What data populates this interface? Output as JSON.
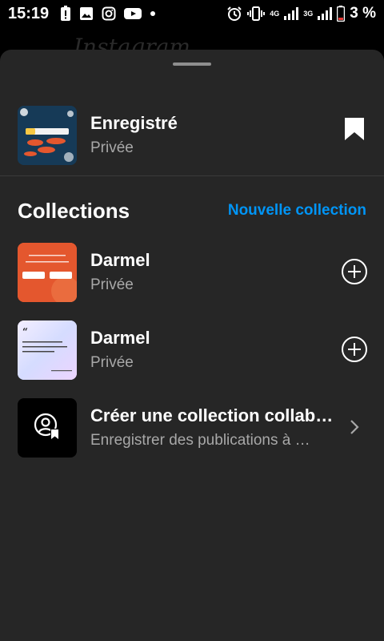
{
  "status_bar": {
    "time": "15:19",
    "network_4g": "4G",
    "network_3g": "3G",
    "battery_percent": "3 %",
    "icons": [
      "alert-icon",
      "gallery-icon",
      "instagram-icon",
      "youtube-icon",
      "dot-icon",
      "alarm-icon",
      "vibrate-icon",
      "signal-icon",
      "battery-icon"
    ]
  },
  "background_app": {
    "title": "Instagram"
  },
  "saved": {
    "title": "Enregistré",
    "subtitle": "Privée",
    "icon": "bookmark-icon"
  },
  "collections": {
    "heading": "Collections",
    "new_collection_label": "Nouvelle collection",
    "items": [
      {
        "title": "Darmel",
        "subtitle": "Privée",
        "action_icon": "add-circle-icon"
      },
      {
        "title": "Darmel",
        "subtitle": "Privée",
        "action_icon": "add-circle-icon"
      }
    ],
    "collab": {
      "title": "Créer une collection collab…",
      "subtitle": "Enregistrer des publications à …",
      "icon": "collab-user-bookmark-icon",
      "action_icon": "chevron-right-icon"
    }
  },
  "thumbnails": {
    "saved_text": "Ne pas manquer des postes essentiels",
    "orange_line1": "POUR CE MOIS",
    "orange_line2": "QUELLE TEAM ES-TU?",
    "orange_tag1": "ORGANISÉE",
    "orange_tag2": "SPONTANÉE",
    "lilac_quote": "Dans chaque épreuve, ne cherche pas l'ennemi, cherche la leçon.",
    "lilac_author": "Meyerson Hunter"
  },
  "colors": {
    "sheet_bg": "#262626",
    "accent_blue": "#0095f6",
    "subtext": "#a8a8a8"
  }
}
